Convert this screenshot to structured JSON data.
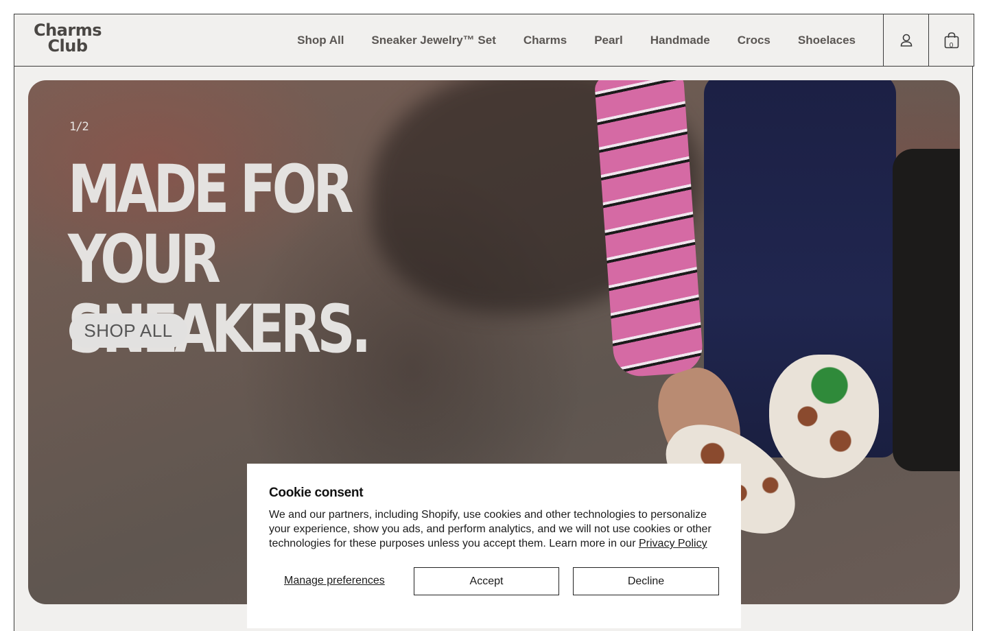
{
  "brand": {
    "logo_line1": "Charms",
    "logo_line2": "Club"
  },
  "nav": {
    "items": [
      {
        "label": "Shop All"
      },
      {
        "label": "Sneaker Jewelry™ Set"
      },
      {
        "label": "Charms"
      },
      {
        "label": "Pearl"
      },
      {
        "label": "Handmade"
      },
      {
        "label": "Crocs"
      },
      {
        "label": "Shoelaces"
      }
    ]
  },
  "header_icons": {
    "account_icon": "account-icon",
    "cart_icon": "shopping-bag-icon",
    "cart_count": "0"
  },
  "hero": {
    "slide_counter": "1/2",
    "title": "MADE FOR YOUR SNEAKERS.",
    "button_label": "SHOP ALL"
  },
  "cookie": {
    "title": "Cookie consent",
    "body": "We and our partners, including Shopify, use cookies and other technologies to personalize your experience, show you ads, and perform analytics, and we will not use cookies or other technologies for these purposes unless you accept them. Learn more in our ",
    "privacy_link": "Privacy Policy",
    "manage_label": "Manage preferences",
    "accept_label": "Accept",
    "decline_label": "Decline"
  },
  "colors": {
    "page_background": "#f1f0ee",
    "border": "#3a3a3a",
    "nav_text": "#5a5653",
    "hero_text": "#e4e2e0"
  }
}
